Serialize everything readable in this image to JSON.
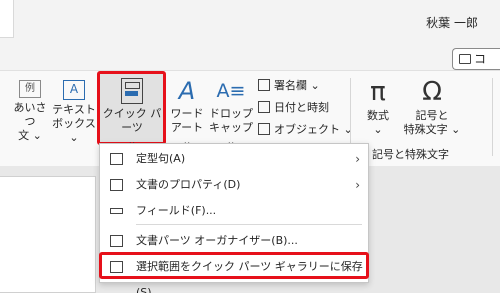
{
  "user": {
    "name": "秋葉 一郎"
  },
  "comment_button": {
    "label": "コ"
  },
  "ribbon": {
    "greeting": {
      "line1": "あいさつ",
      "line2": "文 ⌄",
      "icon_text": "例"
    },
    "textbox": {
      "line1": "テキスト",
      "line2": "ボックス ⌄",
      "icon_text": "A"
    },
    "quickparts": {
      "line1": "クイック パーツ",
      "line2": "⌄"
    },
    "wordart": {
      "line1": "ワード",
      "line2": "アート ⌄",
      "icon_text": "A"
    },
    "dropcap": {
      "line1": "ドロップ",
      "line2": "キャップ ⌄",
      "icon_text": "A≡"
    },
    "signature": {
      "label": "署名欄 ⌄"
    },
    "datetime": {
      "label": "日付と時刻"
    },
    "object": {
      "label": "オブジェクト ⌄"
    },
    "equation": {
      "line1": "数式",
      "line2": "⌄",
      "icon_text": "π"
    },
    "symbol": {
      "line1": "記号と",
      "line2": "特殊文字 ⌄",
      "icon_text": "Ω"
    },
    "symbols_group_label": "記号と特殊文字"
  },
  "menu": {
    "items": [
      {
        "label": "定型句(A)",
        "has_submenu": true
      },
      {
        "label": "文書のプロパティ(D)",
        "has_submenu": true
      },
      {
        "label": "フィールド(F)...",
        "has_submenu": false
      },
      {
        "label": "文書パーツ オーガナイザー(B)...",
        "has_submenu": false
      },
      {
        "label": "選択範囲をクイック パーツ ギャラリーに保存(S)...",
        "has_submenu": false
      }
    ],
    "submenu_arrow": "›"
  },
  "colors": {
    "highlight": "#e6101a",
    "accent": "#2b6cb0"
  }
}
